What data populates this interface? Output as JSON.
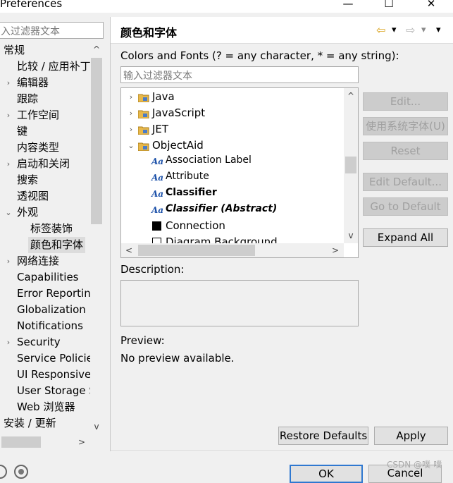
{
  "window": {
    "title": "Preferences",
    "minimize_glyph": "—",
    "maximize_glyph": "☐",
    "close_glyph": "✕"
  },
  "left": {
    "filter_placeholder": "入过滤器文本",
    "tree": [
      {
        "label": "常规",
        "twisty": ""
      },
      {
        "label": "比较 / 应用补丁",
        "twisty": ""
      },
      {
        "label": "编辑器",
        "twisty": "›"
      },
      {
        "label": "跟踪",
        "twisty": ""
      },
      {
        "label": "工作空间",
        "twisty": "›"
      },
      {
        "label": "键",
        "twisty": ""
      },
      {
        "label": "内容类型",
        "twisty": ""
      },
      {
        "label": "启动和关闭",
        "twisty": "›"
      },
      {
        "label": "搜索",
        "twisty": ""
      },
      {
        "label": "透视图",
        "twisty": ""
      },
      {
        "label": "外观",
        "twisty": "⌄"
      },
      {
        "label": "标签装饰",
        "twisty": ""
      },
      {
        "label": "颜色和字体",
        "twisty": ""
      },
      {
        "label": "网络连接",
        "twisty": "›"
      },
      {
        "label": "Capabilities",
        "twisty": ""
      },
      {
        "label": "Error Reporting",
        "twisty": ""
      },
      {
        "label": "Globalization",
        "twisty": ""
      },
      {
        "label": "Notifications",
        "twisty": ""
      },
      {
        "label": "Security",
        "twisty": "›"
      },
      {
        "label": "Service Policies",
        "twisty": ""
      },
      {
        "label": "UI Responsiveness",
        "twisty": ""
      },
      {
        "label": "User Storage Service",
        "twisty": ""
      },
      {
        "label": "Web 浏览器",
        "twisty": ""
      },
      {
        "label": "安装 / 更新",
        "twisty": ""
      }
    ]
  },
  "right": {
    "title": "颜色和字体",
    "nav": {
      "back": "⇦",
      "dropdown": "▾",
      "forward": "⇨",
      "menu": "▾"
    },
    "filter_label": "Colors and Fonts (? = any character, * = any string):",
    "filter_placeholder": "输入过滤器文本",
    "tree": [
      {
        "label": "Java",
        "kind": "category",
        "twisty": "›"
      },
      {
        "label": "JavaScript",
        "kind": "category",
        "twisty": "›"
      },
      {
        "label": "JET",
        "kind": "category",
        "twisty": "›"
      },
      {
        "label": "ObjectAid",
        "kind": "category",
        "twisty": "⌄"
      },
      {
        "label": "Association Label",
        "kind": "font",
        "style": "normal"
      },
      {
        "label": "Attribute",
        "kind": "font",
        "style": "normal"
      },
      {
        "label": "Classifier",
        "kind": "font",
        "style": "bold"
      },
      {
        "label": "Classifier (Abstract)",
        "kind": "font",
        "style": "bold-italic"
      },
      {
        "label": "Connection",
        "kind": "color",
        "color": "#000000"
      },
      {
        "label": "Diagram Background",
        "kind": "color",
        "color": "#ffffff"
      }
    ],
    "font_icon": "Aa",
    "buttons": {
      "edit": "Edit...",
      "use_system_font": "使用系统字体(U)",
      "reset": "Reset",
      "edit_default": "Edit Default...",
      "go_to_default": "Go to Default",
      "expand_all": "Expand All"
    },
    "description_label": "Description:",
    "preview_label": "Preview:",
    "preview_text": "No preview available.",
    "restore_defaults": "Restore Defaults",
    "apply": "Apply"
  },
  "dialog": {
    "ok": "OK",
    "cancel": "Cancel"
  },
  "watermark": "CSDN @噗-噗",
  "scroll": {
    "up": "^",
    "down": "v",
    "left": "<",
    "right": ">"
  }
}
